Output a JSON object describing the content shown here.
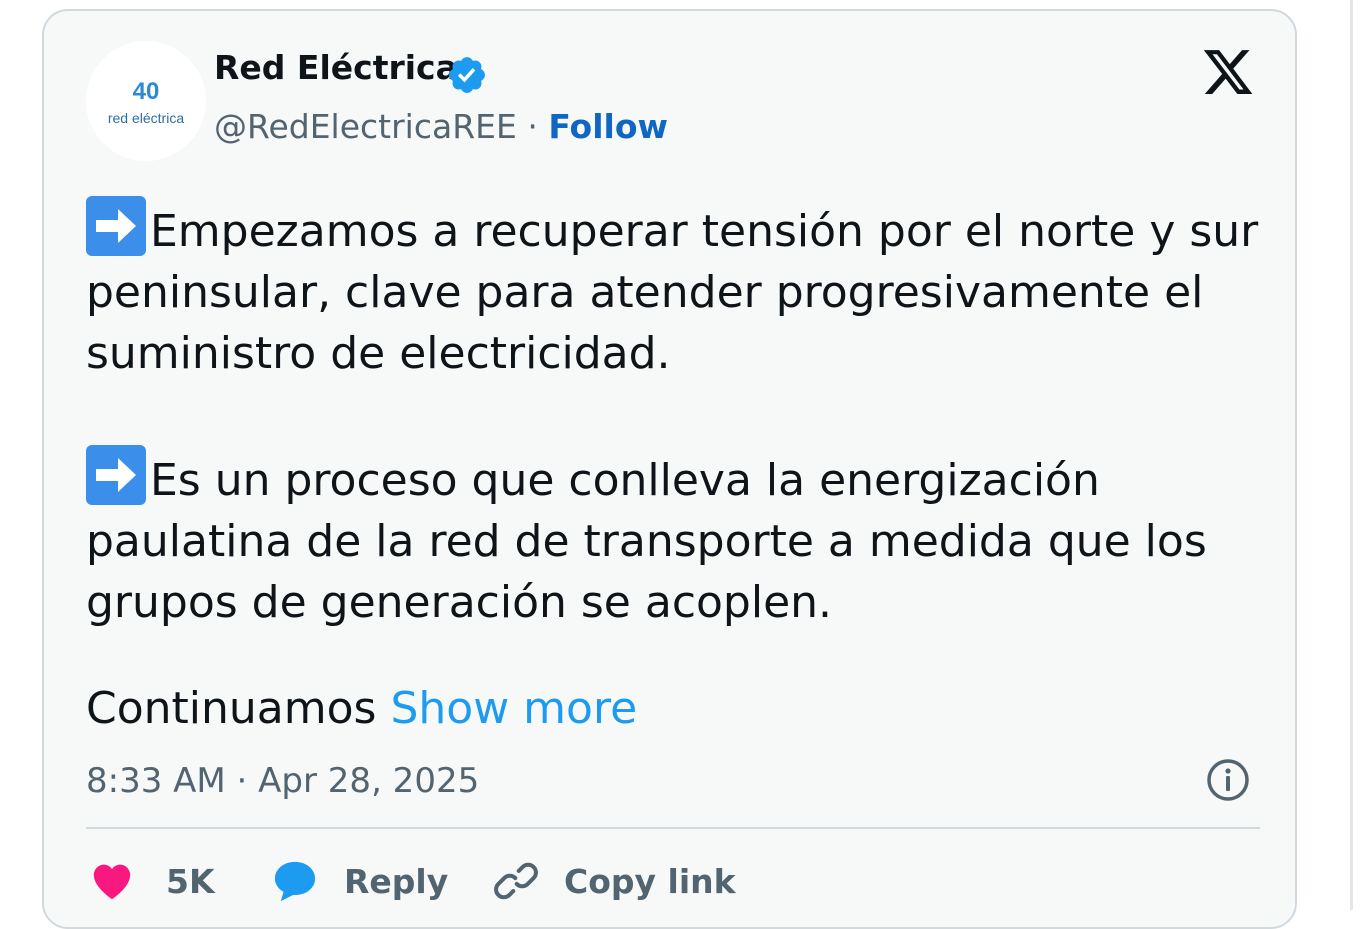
{
  "author": {
    "name": "Red Eléctrica",
    "handle": "@RedElectricaREE",
    "separator": " · ",
    "follow_label": "Follow",
    "verified": true,
    "avatar": {
      "badge_text": "40",
      "logo_text": "red eléctrica",
      "accent_color": "#2a8ad6"
    }
  },
  "brand_icon": "x-logo-icon",
  "tweet": {
    "paragraphs": [
      {
        "emoji": "right-arrow-emoji",
        "text": "Empezamos a recuperar tensión por el norte y sur peninsular, clave para atender progresivamente el suministro de electricidad."
      },
      {
        "emoji": "right-arrow-emoji",
        "text": "Es un proceso que conlleva la energización paulatina de la red de transporte a medida que los grupos de generación se acoplen."
      }
    ],
    "truncated_text": "Continuamos",
    "show_more_label": "Show more"
  },
  "meta": {
    "timestamp": "8:33 AM · Apr 28, 2025",
    "info_icon": "info-icon"
  },
  "actions": {
    "like": {
      "count": "5K",
      "icon": "heart-icon",
      "color": "#f91880"
    },
    "reply": {
      "label": "Reply",
      "icon": "speech-bubble-icon",
      "color": "#1d9bf0"
    },
    "copy": {
      "label": "Copy link",
      "icon": "link-icon"
    }
  },
  "colors": {
    "link": "#1d9bf0",
    "follow": "#0f66c3",
    "verified": "#1d9bf0",
    "text_primary": "#0f1419",
    "text_secondary": "#536471",
    "card_bg": "#f7f9f9",
    "border": "#cfd9de"
  }
}
